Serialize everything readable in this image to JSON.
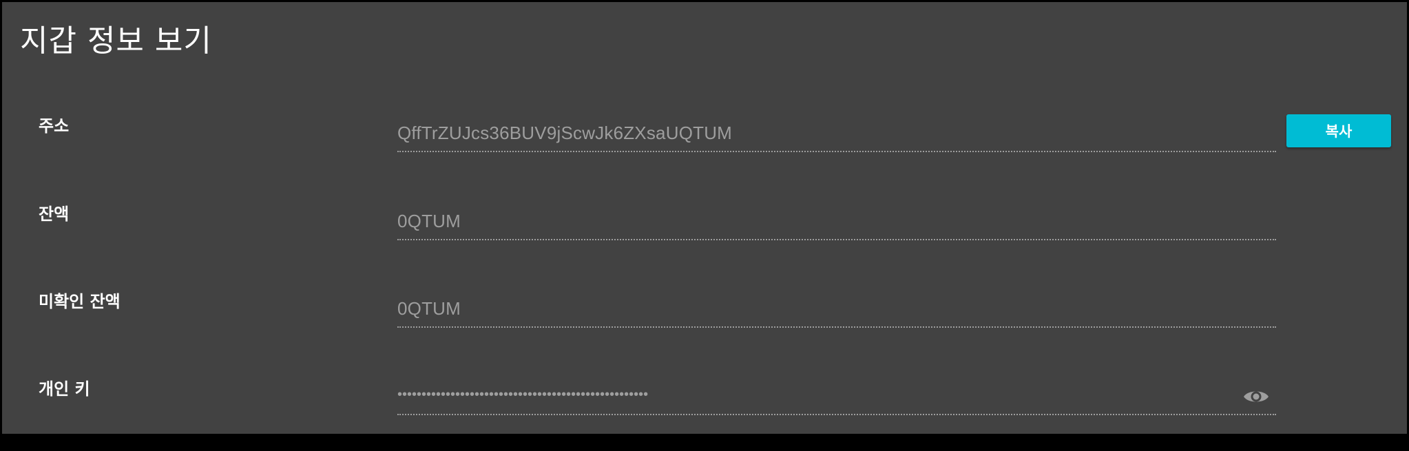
{
  "dialog": {
    "title": "지갑 정보 보기"
  },
  "fields": {
    "address": {
      "label": "주소",
      "value": "QffTrZUJcs36BUV9jScwJk6ZXsaUQTUM"
    },
    "balance": {
      "label": "잔액",
      "value": "0QTUM"
    },
    "unconfirmed_balance": {
      "label": "미확인 잔액",
      "value": "0QTUM"
    },
    "private_key": {
      "label": "개인 키",
      "value": "••••••••••••••••••••••••••••••••••••••••••••••••••••",
      "icon": "eye-icon"
    }
  },
  "actions": {
    "copy_label": "복사"
  },
  "colors": {
    "background": "#424242",
    "accent": "#00bcd4",
    "muted_text": "#9e9e9e",
    "text": "#ffffff"
  }
}
